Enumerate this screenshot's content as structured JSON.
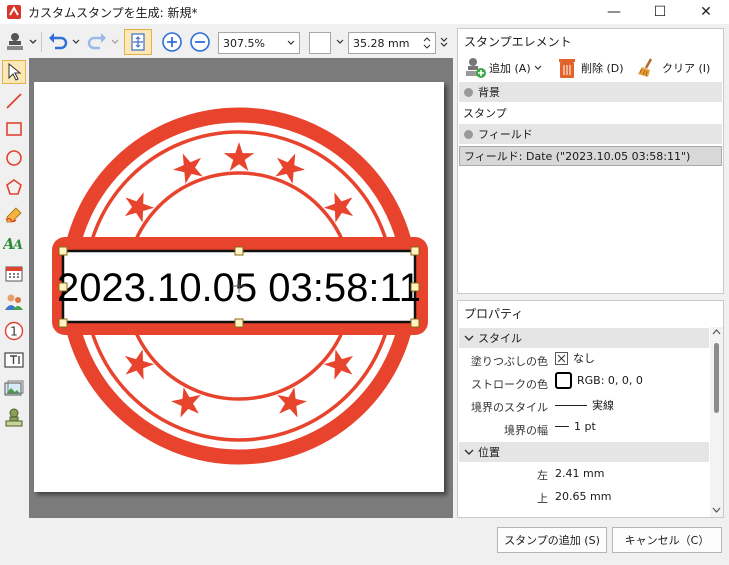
{
  "window": {
    "title": "カスタムスタンプを生成: 新規*",
    "minimize": "—",
    "maximize": "☐",
    "close": "✕"
  },
  "toolbar": {
    "zoom_value": "307.5%",
    "line_width_value": "35.28 mm",
    "accent_color": "#2f6fd8"
  },
  "stamp": {
    "text": "2023.10.05 03:58:11",
    "color": "#e8432d"
  },
  "elements_panel": {
    "title": "スタンプエレメント",
    "add_label": "追加 (A)",
    "delete_label": "削除 (D)",
    "clear_label": "クリア (I)",
    "groups": [
      {
        "label": "背景",
        "items": [
          "スタンプ"
        ]
      },
      {
        "label": "フィールド",
        "items": [
          "フィールド: Date (\"2023.10.05 03:58:11\")"
        ]
      }
    ]
  },
  "properties_panel": {
    "title": "プロパティ",
    "style_group": "スタイル",
    "fill_label": "塗りつぶしの色",
    "fill_value": "なし",
    "stroke_label": "ストロークの色",
    "stroke_value": "RGB: 0, 0, 0",
    "border_style_label": "境界のスタイル",
    "border_style_value": "実線",
    "border_width_label": "境界の幅",
    "border_width_value": "1 pt",
    "position_group": "位置",
    "left_label": "左",
    "left_value": "2.41 mm",
    "top_label": "上",
    "top_value": "20.65 mm"
  },
  "footer": {
    "add_stamp": "スタンプの追加 (S)",
    "cancel": "キャンセル（C）"
  }
}
